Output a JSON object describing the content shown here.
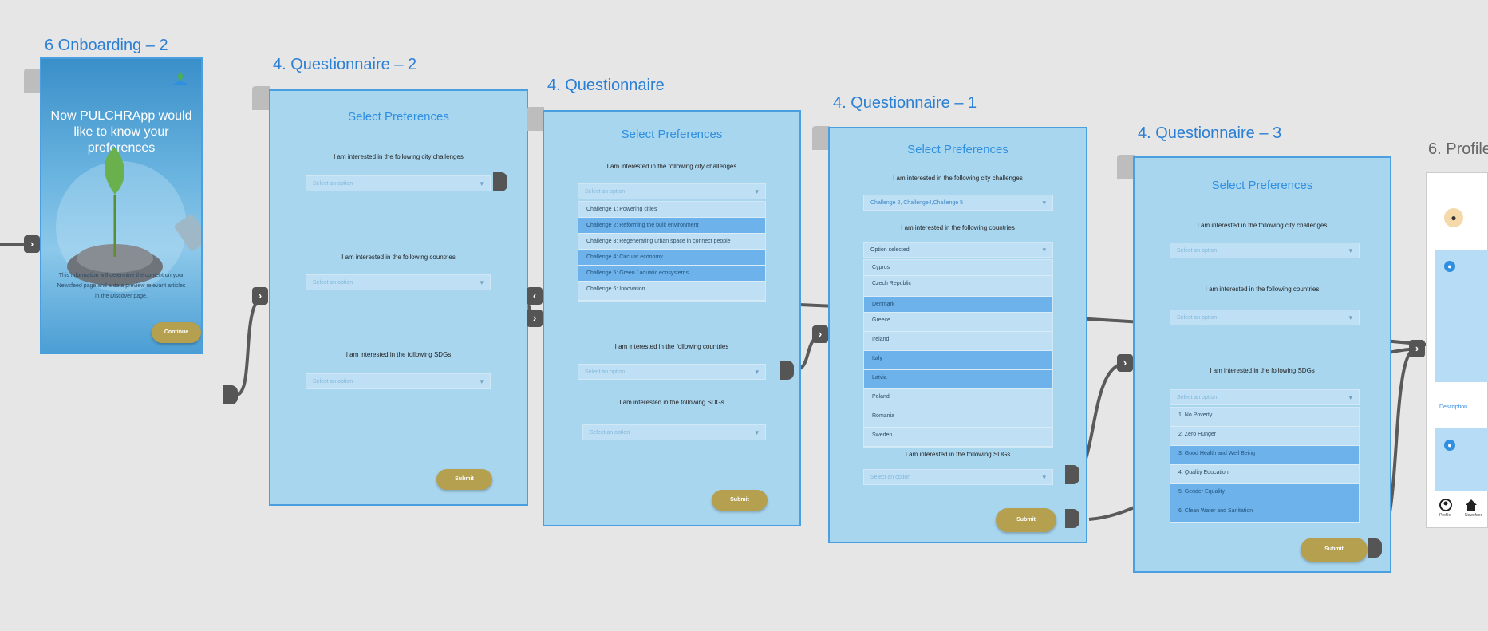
{
  "frames": {
    "onboarding": {
      "title": "6 Onboarding – 2",
      "heading": "Now PULCHRApp would like to know your preferences",
      "info": "This information will determine the content on your Newsfeed page and a data preview relevant articles in the Discover page.",
      "continue": "Continue"
    },
    "q2": {
      "title": "4. Questionnaire – 2",
      "heading": "Select Preferences",
      "label_challenges": "I am interested in the following city challenges",
      "label_countries": "I am interested in the following countries",
      "label_sdgs": "I am interested in the following SDGs",
      "placeholder": "Select an option",
      "submit": "Submit"
    },
    "q": {
      "title": "4. Questionnaire",
      "heading": "Select Preferences",
      "label_challenges": "I am interested in the following city challenges",
      "label_countries": "I am interested in the following countries",
      "label_sdgs": "I am interested in the following SDGs",
      "placeholder": "Select an option",
      "challenges": [
        {
          "label": "Challenge 1: Powering cities",
          "selected": false
        },
        {
          "label": "Challenge 2: Reforming the built environment",
          "selected": true
        },
        {
          "label": "Challenge 3: Regenerating urban space in connect people",
          "selected": false
        },
        {
          "label": "Challenge 4: Circular economy",
          "selected": true
        },
        {
          "label": "Challenge 5: Green / aquatic ecosystems",
          "selected": true
        },
        {
          "label": "Challenge 6: Innovation",
          "selected": false
        }
      ],
      "submit": "Submit"
    },
    "q1": {
      "title": "4. Questionnaire – 1",
      "heading": "Select Preferences",
      "label_challenges": "I am interested in the following city challenges",
      "challenges_value": "Challenge 2, Challenge4,Challenge 5",
      "label_countries": "I am interested in the following countries",
      "countries_value": "Option selected",
      "countries": [
        {
          "label": "Cyprus",
          "selected": false
        },
        {
          "label": "Czech Republic",
          "selected": false
        },
        {
          "label": "Denmark",
          "selected": true
        },
        {
          "label": "Greece",
          "selected": false
        },
        {
          "label": "Ireland",
          "selected": false
        },
        {
          "label": "Italy",
          "selected": true
        },
        {
          "label": "Latvia",
          "selected": true
        },
        {
          "label": "Poland",
          "selected": false
        },
        {
          "label": "Romania",
          "selected": false
        },
        {
          "label": "Sweden",
          "selected": false
        }
      ],
      "label_sdgs": "I am interested in the following SDGs",
      "placeholder": "Select an option",
      "submit": "Submit"
    },
    "q3": {
      "title": "4. Questionnaire – 3",
      "heading": "Select Preferences",
      "label_challenges": "I am interested in the following city challenges",
      "label_countries": "I am interested in the following countries",
      "label_sdgs": "I am interested in the following SDGs",
      "placeholder": "Select an option",
      "sdgs": [
        {
          "label": "1. No Poverty",
          "selected": false
        },
        {
          "label": "2. Zero Hunger",
          "selected": false
        },
        {
          "label": "3. Good Health and Well Being",
          "selected": true
        },
        {
          "label": "4. Quality Education",
          "selected": false
        },
        {
          "label": "5. Gender Equality",
          "selected": true
        },
        {
          "label": "6. Clean Water and Sanitation",
          "selected": true
        }
      ],
      "submit": "Submit"
    },
    "profile": {
      "title": "6. Profile",
      "description": "Description",
      "nav_profile": "Profile",
      "nav_home": "Newsfeed"
    }
  },
  "colors": {
    "accent": "#2f8fe0",
    "screen_bg": "#a9d6ef",
    "button": "#b5a050",
    "connector": "#555555"
  }
}
